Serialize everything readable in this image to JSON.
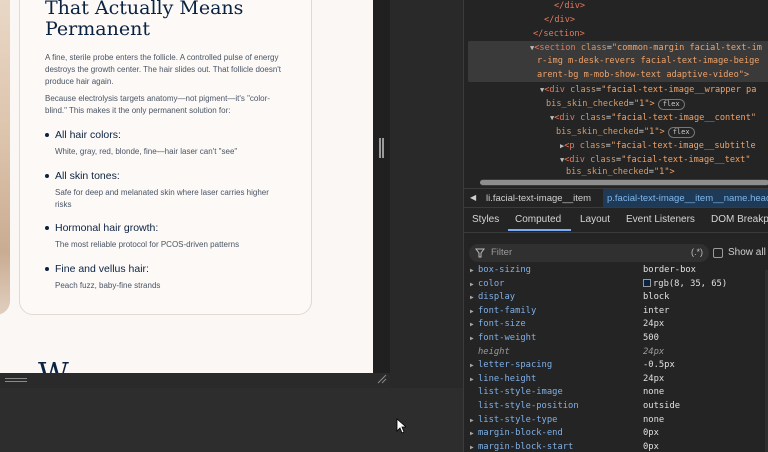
{
  "preview": {
    "title": "That Actually Means Permanent",
    "para1": "A fine, sterile probe enters the follicle. A controlled pulse of energy destroys the growth center. The hair slides out. That follicle doesn't produce hair again.",
    "para2": "Because electrolysis targets anatomy—not pigment—it's \"color-blind.\" This makes it the only permanent solution for:",
    "features": [
      {
        "heading": "All hair colors:",
        "desc": "White, gray, red, blonde, fine—hair laser can't \"see\""
      },
      {
        "heading": "All skin tones:",
        "desc": "Safe for deep and melanated skin where laser carries higher risks"
      },
      {
        "heading": "Hormonal hair growth:",
        "desc": "The most reliable protocol for PCOS-driven patterns"
      },
      {
        "heading": "Fine and vellus hair:",
        "desc": "Peach fuzz, baby-fine strands"
      }
    ],
    "next_heading": "W"
  },
  "devtools": {
    "dom_lines": {
      "l0": "</div>",
      "l1": "</div>",
      "l2": "</section>",
      "l3_tag": "section",
      "l3_attr": "class",
      "l3_val_a": "\"common-margin facial-text-im",
      "l4_val": "r-img m-desk-revers facial-text-image-beige",
      "l5_val": "arent-bg m-mob-show-text adaptive-video\">",
      "l6_tag": "div",
      "l6_attr": "class",
      "l6_val": "\"facial-text-image__wrapper pa",
      "l7_attr": "bis_skin_checked",
      "l7_val": "\"1\">",
      "l8_tag": "div",
      "l8_attr": "class",
      "l8_val": "\"facial-text-image__content\"",
      "l9_attr": "bis_skin_checked",
      "l9_val": "\"1\">",
      "l10_tag": "p",
      "l10_attr": "class",
      "l10_val": "\"facial-text-image__subtitle",
      "l11_tag": "div",
      "l11_attr": "class",
      "l11_val": "\"facial-text-image__text\"",
      "l12_attr": "bis_skin_checked",
      "l12_val": "\"1\">",
      "flex_badge": "flex"
    },
    "breadcrumb": {
      "item1": "li.facial-text-image__item",
      "item2": "p.facial-text-image__item__name.head"
    },
    "tabs": [
      "Styles",
      "Computed",
      "Layout",
      "Event Listeners",
      "DOM Breakp"
    ],
    "active_tab": "Computed",
    "filter_placeholder": "Filter",
    "regex_label": "(.*)",
    "show_all_label": "Show all",
    "accent_color": "#7cacf8",
    "properties": [
      {
        "name": "box-sizing",
        "value": "border-box",
        "expandable": true
      },
      {
        "name": "color",
        "value": "rgb(8, 35, 65)",
        "expandable": true,
        "swatch": "#082341"
      },
      {
        "name": "display",
        "value": "block",
        "expandable": true
      },
      {
        "name": "font-family",
        "value": "inter",
        "expandable": true
      },
      {
        "name": "font-size",
        "value": "24px",
        "expandable": true
      },
      {
        "name": "font-weight",
        "value": "500",
        "expandable": true
      },
      {
        "name": "height",
        "value": "24px",
        "expandable": false,
        "inherited": true
      },
      {
        "name": "letter-spacing",
        "value": "-0.5px",
        "expandable": true
      },
      {
        "name": "line-height",
        "value": "24px",
        "expandable": true
      },
      {
        "name": "list-style-image",
        "value": "none",
        "expandable": false
      },
      {
        "name": "list-style-position",
        "value": "outside",
        "expandable": false
      },
      {
        "name": "list-style-type",
        "value": "none",
        "expandable": true
      },
      {
        "name": "margin-block-end",
        "value": "0px",
        "expandable": true
      },
      {
        "name": "margin-block-start",
        "value": "0px",
        "expandable": true
      }
    ]
  }
}
